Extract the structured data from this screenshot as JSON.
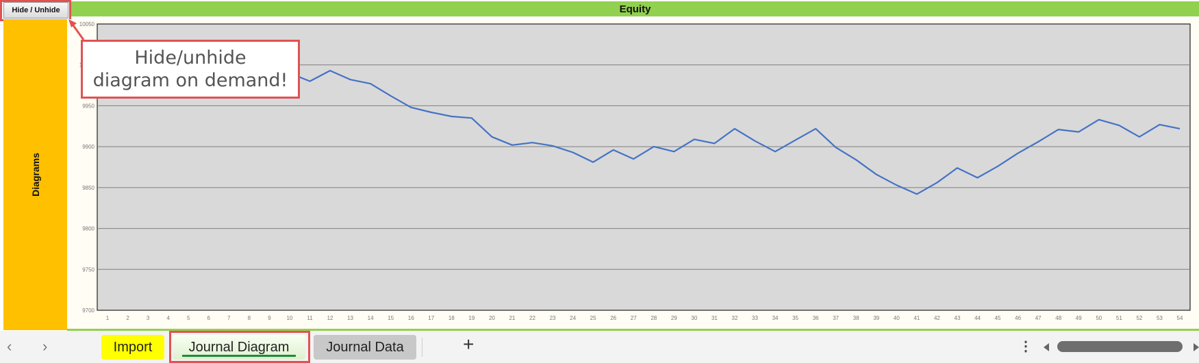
{
  "toolbar": {
    "hide_unhide_label": "Hide / Unhide"
  },
  "header": {
    "title": "Equity"
  },
  "sidebar": {
    "label": "Diagrams"
  },
  "callout": {
    "line1": "Hide/unhide",
    "line2": "diagram on demand!"
  },
  "colors": {
    "header_bg": "#92d050",
    "sidebar_bg": "#ffc000",
    "plot_bg": "#d9d9d9",
    "series_line": "#4472c4",
    "highlight": "#e05252",
    "import_tab_bg": "#ffff00"
  },
  "tabs": [
    {
      "label": "Import",
      "active": false
    },
    {
      "label": "Journal Diagram",
      "active": true
    },
    {
      "label": "Journal Data",
      "active": false
    }
  ],
  "tabbar": {
    "add_label": "+",
    "prev_icon": "chevron-left",
    "next_icon": "chevron-right",
    "more_icon": "vertical-ellipsis"
  },
  "chart_data": {
    "type": "line",
    "title": "Equity",
    "xlabel": "",
    "ylabel": "",
    "ylim": [
      9700,
      10050
    ],
    "yticks": [
      9700,
      9750,
      9800,
      9850,
      9900,
      9950,
      10000,
      10050
    ],
    "grid": true,
    "legend": "none",
    "x": [
      1,
      2,
      3,
      4,
      5,
      6,
      7,
      8,
      9,
      10,
      11,
      12,
      13,
      14,
      15,
      16,
      17,
      18,
      19,
      20,
      21,
      22,
      23,
      24,
      25,
      26,
      27,
      28,
      29,
      30,
      31,
      32,
      33,
      34,
      35,
      36,
      37,
      38,
      39,
      40,
      41,
      42,
      43,
      44,
      45,
      46,
      47,
      48,
      49,
      50,
      51,
      52,
      53,
      54
    ],
    "series": [
      {
        "name": "Equity",
        "values": [
          10000,
          9995,
          9990,
          9985,
          9992,
          9988,
          9996,
          9990,
          9985,
          9990,
          9980,
          9993,
          9982,
          9977,
          9962,
          9948,
          9942,
          9937,
          9935,
          9912,
          9902,
          9905,
          9901,
          9893,
          9881,
          9896,
          9885,
          9900,
          9894,
          9909,
          9904,
          9922,
          9907,
          9894,
          9908,
          9922,
          9899,
          9884,
          9866,
          9853,
          9842,
          9856,
          9874,
          9862,
          9876,
          9892,
          9906,
          9921,
          9918,
          9933,
          9926,
          9912,
          9927,
          9922
        ]
      }
    ]
  }
}
